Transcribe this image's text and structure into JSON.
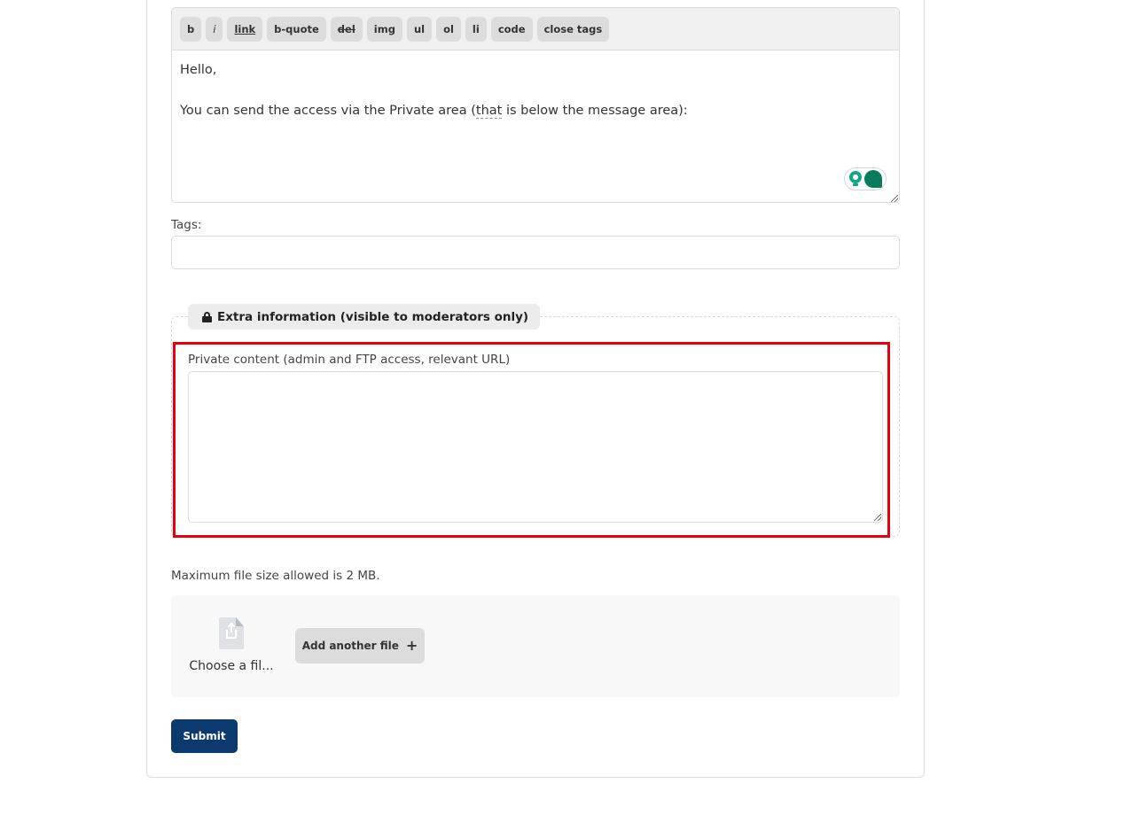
{
  "editor": {
    "toolbar": [
      {
        "label": "b",
        "style": "bold"
      },
      {
        "label": "i",
        "style": "italic"
      },
      {
        "label": "link",
        "style": "underline"
      },
      {
        "label": "b-quote",
        "style": "normal"
      },
      {
        "label": "del",
        "style": "strike"
      },
      {
        "label": "img",
        "style": "normal"
      },
      {
        "label": "ul",
        "style": "normal"
      },
      {
        "label": "ol",
        "style": "normal"
      },
      {
        "label": "li",
        "style": "normal"
      },
      {
        "label": "code",
        "style": "normal"
      },
      {
        "label": "close tags",
        "style": "normal"
      }
    ],
    "content": {
      "line1": "Hello,",
      "line2_before": "You can send the access via the Private area (",
      "line2_flagged": "that",
      "line2_after": " is below the message area):"
    },
    "widget_icons": [
      "lightbulb-icon",
      "assistant-blob-icon"
    ]
  },
  "tags": {
    "label": "Tags:",
    "value": "",
    "placeholder": ""
  },
  "extra_info": {
    "legend": "Extra information (visible to moderators only)",
    "legend_icon": "lock-icon",
    "private_label": "Private content (admin and FTP access, relevant URL)",
    "private_value": "",
    "highlight_color": "#e8000b"
  },
  "upload": {
    "max_size_note": "Maximum file size allowed is 2 MB.",
    "choose_file_label": "Choose a fil...",
    "add_another_label": "Add another file",
    "add_icon": "+"
  },
  "form": {
    "submit_label": "Submit",
    "submit_color": "#0d3a6e"
  }
}
